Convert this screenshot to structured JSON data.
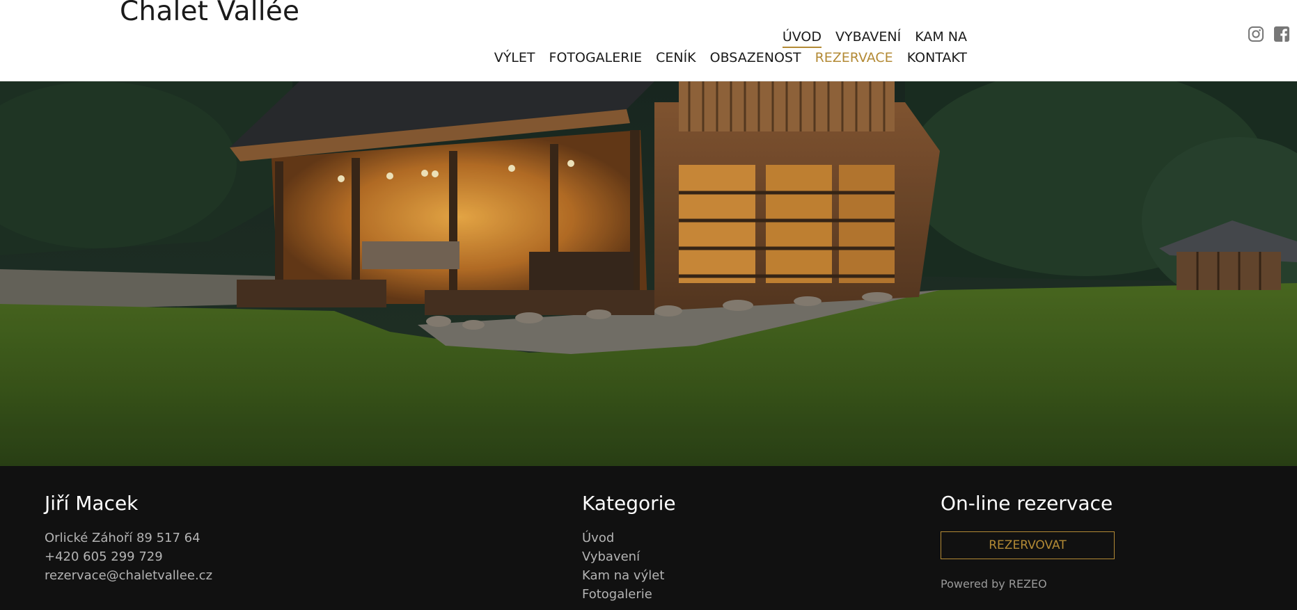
{
  "header": {
    "logo": "Chalet Vallée",
    "nav_row1": [
      {
        "label": "ÚVOD",
        "active": true
      },
      {
        "label": "VYBAVENÍ"
      },
      {
        "label": "KAM NA"
      }
    ],
    "nav_row2": [
      {
        "label": "VÝLET"
      },
      {
        "label": "FOTOGALERIE"
      },
      {
        "label": "CENÍK"
      },
      {
        "label": "OBSAZENOST"
      },
      {
        "label": "REZERVACE",
        "accent": true
      },
      {
        "label": "KONTAKT"
      }
    ],
    "social": [
      "instagram-icon",
      "facebook-icon"
    ]
  },
  "hero": {
    "scroll_icon": "arrow-down-circle-icon"
  },
  "footer": {
    "contact": {
      "title": "Jiří Macek",
      "address": "Orlické Záhoří 89 517 64",
      "phone": "+420 605 299 729",
      "email": "rezervace@chaletvallee.cz"
    },
    "categories": {
      "title": "Kategorie",
      "items": [
        "Úvod",
        "Vybavení",
        "Kam na výlet",
        "Fotogalerie"
      ]
    },
    "booking": {
      "title": "On-line rezervace",
      "button_label": "REZERVOVAT",
      "powered_by": "Powered by REZEO"
    }
  },
  "colors": {
    "accent": "#b38a35",
    "footer_bg": "#111111"
  }
}
